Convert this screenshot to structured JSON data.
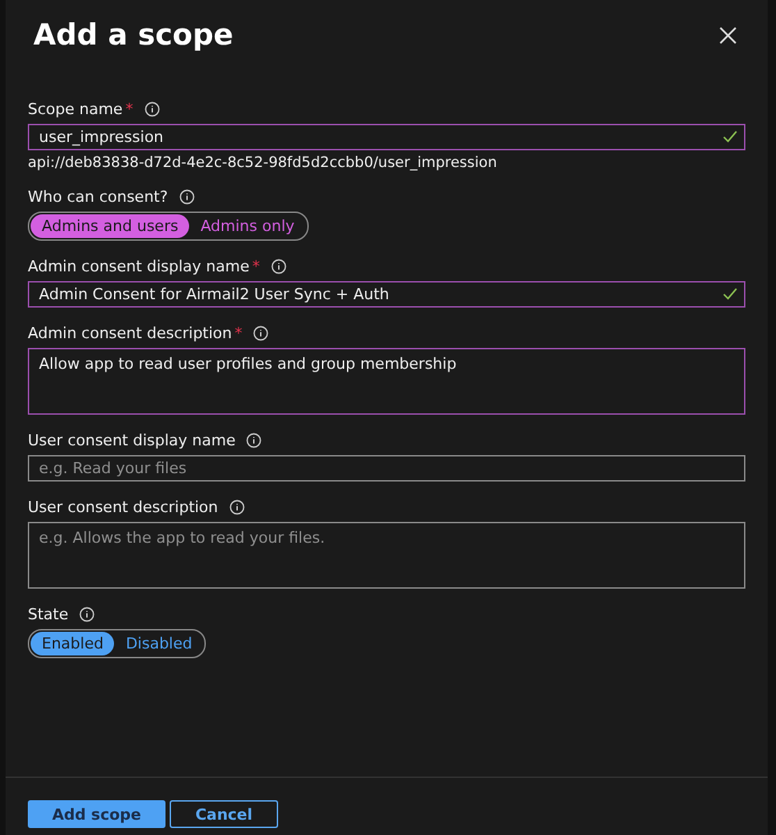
{
  "title": "Add a scope",
  "fields": [
    {
      "kind": "input",
      "label": "Scope name",
      "required_mark": "*",
      "value": "user_impression",
      "valid": true,
      "note": "api://deb83838-d72d-4e2c-8c52-98fd5d2ccbb0/user_impression"
    },
    {
      "kind": "toggle",
      "label": "Who can consent?",
      "color": "#d35fe0",
      "options": [
        {
          "label": "Admins and users",
          "selected": true
        },
        {
          "label": "Admins only",
          "selected": false
        }
      ]
    },
    {
      "kind": "input",
      "label": "Admin consent display name",
      "required_mark": "*",
      "value": "Admin Consent for Airmail2 User Sync + Auth",
      "valid": true
    },
    {
      "kind": "textarea",
      "label": "Admin consent description",
      "required_mark": "*",
      "value": "Allow app to read user profiles and group membership"
    },
    {
      "kind": "input",
      "label": "User consent display name",
      "placeholder": "e.g. Read your files"
    },
    {
      "kind": "textarea",
      "label": "User consent description",
      "placeholder": "e.g. Allows the app to read your files."
    },
    {
      "kind": "toggle",
      "label": "State",
      "color": "#4ea1f3",
      "options": [
        {
          "label": "Enabled",
          "selected": true
        },
        {
          "label": "Disabled",
          "selected": false
        }
      ]
    }
  ],
  "buttons": [
    {
      "label": "Add scope",
      "primary": true
    },
    {
      "label": "Cancel",
      "primary": false
    }
  ]
}
